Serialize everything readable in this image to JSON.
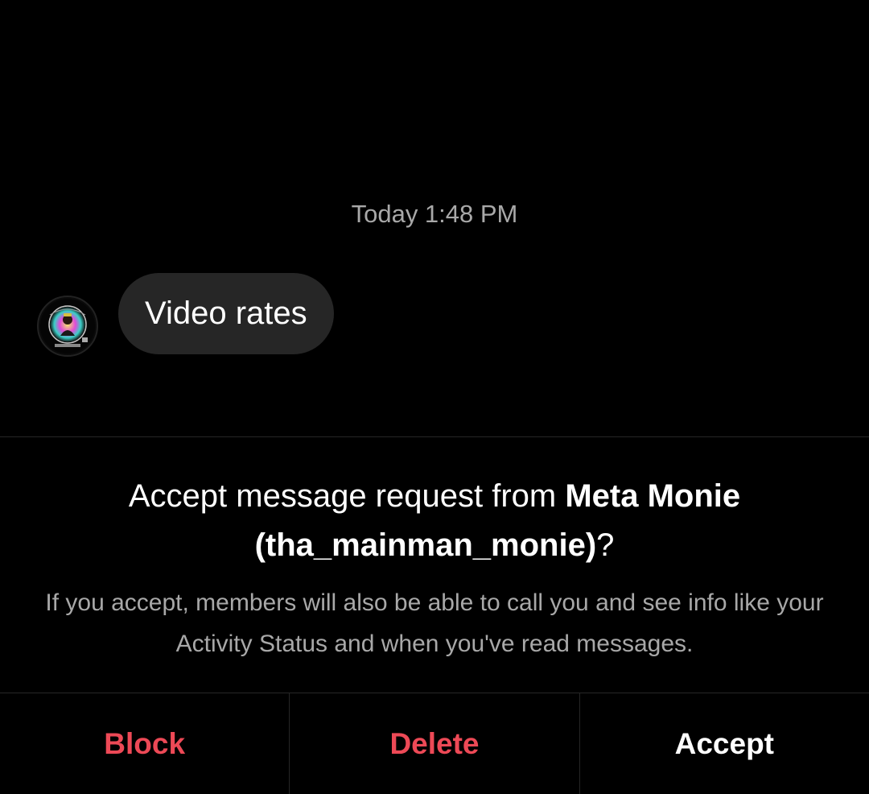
{
  "conversation": {
    "timestamp": "Today 1:48 PM",
    "messages": [
      {
        "text": "Video rates"
      }
    ]
  },
  "request": {
    "prefix": "Accept message request from ",
    "display_name": "Meta Monie",
    "username": "(tha_mainman_monie)",
    "suffix": "?",
    "description": "If you accept, members will also be able to call you and see info like your Activity Status and when you've read messages."
  },
  "actions": {
    "block_label": "Block",
    "delete_label": "Delete",
    "accept_label": "Accept"
  },
  "colors": {
    "background": "#000000",
    "bubble": "#262626",
    "secondary_text": "#a8a8a8",
    "danger": "#ed4956",
    "divider": "#262626"
  },
  "icons": {
    "avatar": "sender-avatar-image"
  }
}
